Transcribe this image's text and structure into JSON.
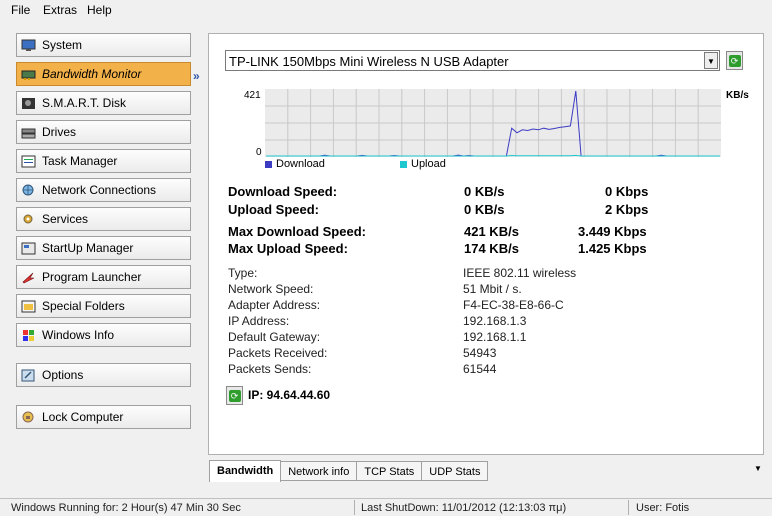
{
  "menu": {
    "file": "File",
    "extras": "Extras",
    "help": "Help"
  },
  "sidebar": {
    "items": [
      {
        "label": "System",
        "icon": "monitor-icon"
      },
      {
        "label": "Bandwidth Monitor",
        "icon": "network-card-icon",
        "active": true
      },
      {
        "label": "S.M.A.R.T. Disk",
        "icon": "disk-icon"
      },
      {
        "label": "Drives",
        "icon": "drives-icon"
      },
      {
        "label": "Task Manager",
        "icon": "task-manager-icon"
      },
      {
        "label": "Network Connections",
        "icon": "globe-icon"
      },
      {
        "label": "Services",
        "icon": "services-icon"
      },
      {
        "label": "StartUp Manager",
        "icon": "startup-icon"
      },
      {
        "label": "Program Launcher",
        "icon": "launcher-icon"
      },
      {
        "label": "Special Folders",
        "icon": "folder-icon"
      },
      {
        "label": "Windows Info",
        "icon": "windows-icon"
      },
      {
        "label": "Options",
        "icon": "options-icon"
      },
      {
        "label": "Lock Computer",
        "icon": "lock-icon"
      }
    ],
    "arrows": "»"
  },
  "adapter": {
    "selected": "TP-LINK 150Mbps Mini Wireless N USB Adapter"
  },
  "graph": {
    "max_label": "421",
    "zero_label": "0",
    "unit": "KB/s"
  },
  "chart_data": {
    "type": "line",
    "ylim": [
      0,
      421
    ],
    "ylabel": "KB/s",
    "series": [
      {
        "name": "Download",
        "color": "#3b3bc4",
        "values": [
          0,
          0,
          0,
          0,
          0,
          0,
          0,
          0,
          0,
          0,
          0,
          5,
          0,
          0,
          0,
          0,
          0,
          0,
          4,
          0,
          0,
          0,
          0,
          0,
          3,
          0,
          0,
          0,
          0,
          0,
          0,
          0,
          0,
          0,
          0,
          0,
          6,
          0,
          3,
          0,
          0,
          0,
          0,
          0,
          0,
          0,
          180,
          150,
          170,
          165,
          175,
          170,
          180,
          172,
          178,
          185,
          190,
          195,
          421,
          0,
          0,
          0,
          0,
          0,
          0,
          0,
          0,
          0,
          0,
          0,
          0,
          0,
          0,
          0,
          5,
          0,
          0,
          0,
          0,
          0,
          0,
          0,
          0,
          0,
          0,
          0
        ]
      },
      {
        "name": "Upload",
        "color": "#1fc7d0",
        "values": [
          0,
          0,
          0,
          0,
          0,
          0,
          0,
          0,
          0,
          0,
          0,
          0,
          0,
          0,
          0,
          0,
          0,
          0,
          0,
          0,
          0,
          0,
          0,
          0,
          0,
          0,
          0,
          0,
          0,
          0,
          0,
          0,
          0,
          0,
          0,
          0,
          0,
          0,
          0,
          0,
          0,
          0,
          0,
          0,
          0,
          0,
          3,
          2,
          2,
          2,
          2,
          2,
          2,
          2,
          2,
          2,
          2,
          2,
          4,
          0,
          0,
          0,
          0,
          0,
          0,
          0,
          0,
          0,
          0,
          0,
          0,
          0,
          0,
          0,
          0,
          0,
          0,
          0,
          0,
          0,
          0,
          0,
          0,
          0,
          0,
          0
        ]
      }
    ]
  },
  "stats": {
    "download_label": "Download Speed:",
    "download_kb": "0 KB/s",
    "download_kbps": "0 Kbps",
    "upload_label": "Upload Speed:",
    "upload_kb": "0 KB/s",
    "upload_kbps": "2 Kbps",
    "maxdl_label": "Max Download Speed:",
    "maxdl_kb": "421 KB/s",
    "maxdl_kbps": "3.449 Kbps",
    "maxul_label": "Max Upload Speed:",
    "maxul_kb": "174 KB/s",
    "maxul_kbps": "1.425 Kbps"
  },
  "info": [
    {
      "label": "Type:",
      "value": "IEEE 802.11 wireless"
    },
    {
      "label": "Network Speed:",
      "value": "51 Mbit / s."
    },
    {
      "label": "Adapter Address:",
      "value": "F4-EC-38-E8-66-C"
    },
    {
      "label": "IP Address:",
      "value": "192.168.1.3"
    },
    {
      "label": "Default Gateway:",
      "value": "192.168.1.1"
    },
    {
      "label": "Packets Received:",
      "value": "54943"
    },
    {
      "label": "Packets Sends:",
      "value": "61544"
    }
  ],
  "ip": {
    "text": "IP: 94.64.44.60"
  },
  "tabs": [
    "Bandwidth",
    "Network info",
    "TCP Stats",
    "UDP Stats"
  ],
  "status": {
    "running": "Windows Running for: 2 Hour(s) 47 Min 30 Sec",
    "shutdown": "Last ShutDown: 11/01/2012 (12:13:03 πμ)",
    "user": "User: Fotis"
  }
}
